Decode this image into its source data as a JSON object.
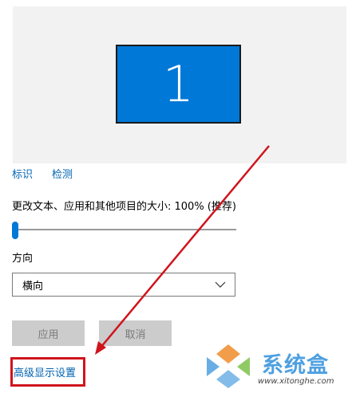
{
  "display": {
    "monitor_number": "1",
    "monitor_color": "#0078d7"
  },
  "links": {
    "identify": "标识",
    "detect": "检测",
    "advanced": "高级显示设置"
  },
  "scale": {
    "label": "更改文本、应用和其他项目的大小: 100% (推荐)",
    "slider_value": 0
  },
  "orientation": {
    "label": "方向",
    "selected": "横向"
  },
  "buttons": {
    "apply": "应用",
    "cancel": "取消"
  },
  "annotation": {
    "highlight_color": "#d0141c"
  },
  "watermark": {
    "brand": "系统盒",
    "url": "www.xitonghe.com"
  }
}
